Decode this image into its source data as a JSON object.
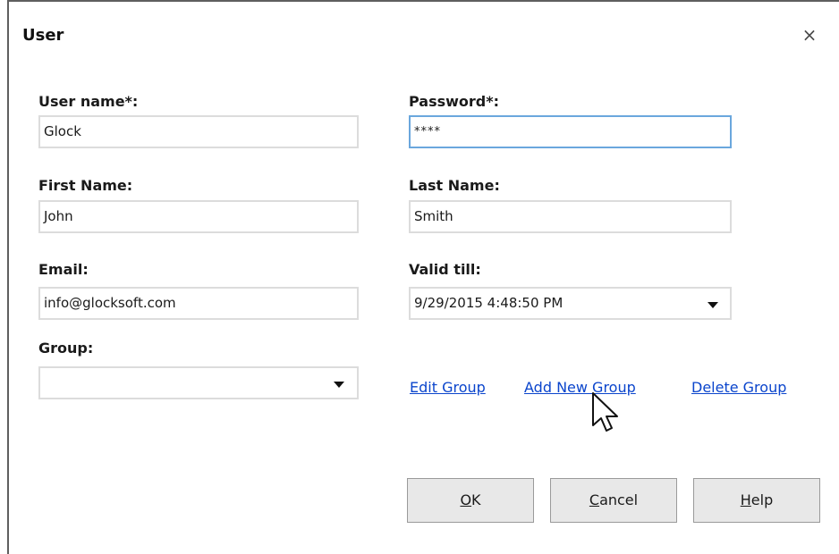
{
  "dialog": {
    "title": "User",
    "close_glyph": "×"
  },
  "form": {
    "username_label": "User name*:",
    "username_value": "Glock",
    "password_label": "Password*:",
    "password_value": "****",
    "first_name_label": "First Name:",
    "first_name_value": "John",
    "last_name_label": "Last Name:",
    "last_name_value": "Smith",
    "email_label": "Email:",
    "email_value": "info@glocksoft.com",
    "valid_till_label": "Valid till:",
    "valid_till_value": "9/29/2015 4:48:50 PM",
    "group_label": "Group:",
    "group_value": ""
  },
  "links": {
    "edit_group": "Edit Group",
    "add_new_group": "Add New Group",
    "delete_group": "Delete Group"
  },
  "buttons": {
    "ok": {
      "pre": "",
      "accel": "O",
      "post": "K"
    },
    "cancel": {
      "pre": "",
      "accel": "C",
      "post": "ancel"
    },
    "help": {
      "pre": "",
      "accel": "H",
      "post": "elp"
    }
  },
  "icons": {
    "close": "close-icon",
    "dropdown": "chevron-down-icon",
    "cursor": "mouse-pointer-icon"
  },
  "colors": {
    "link": "#0b45cc",
    "focus_border": "#6aa7dd",
    "field_border": "#dcdcdc",
    "button_bg": "#e8e8e8"
  }
}
